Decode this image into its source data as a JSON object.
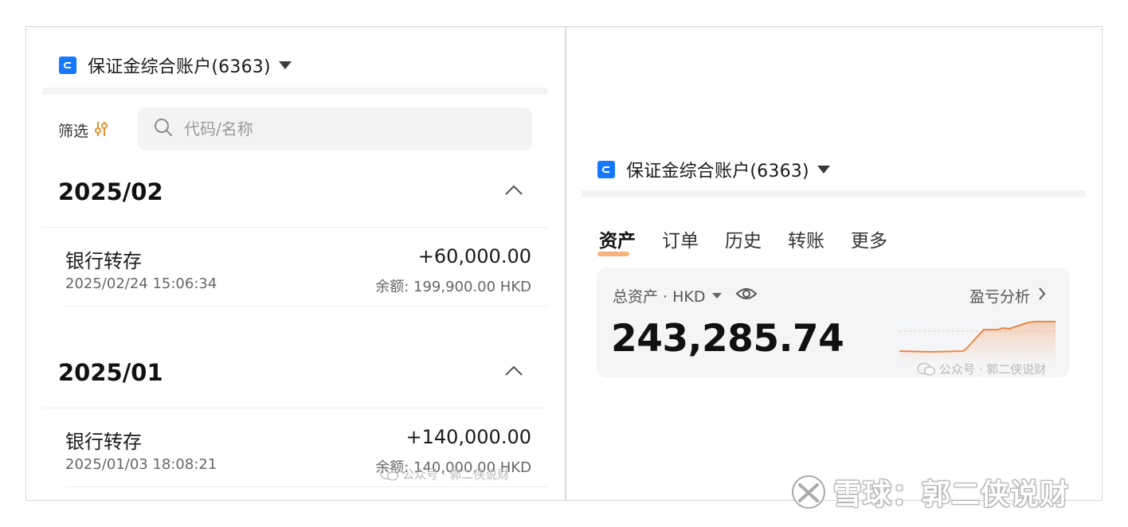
{
  "account": {
    "title": "保证金综合账户(6363)"
  },
  "left": {
    "filter_label": "筛选",
    "search_placeholder": "代码/名称",
    "groups": [
      {
        "month": "2025/02",
        "items": [
          {
            "type": "银行转存",
            "time": "2025/02/24 15:06:34",
            "amount": "+60,000.00",
            "balance": "余额: 199,900.00 HKD"
          }
        ]
      },
      {
        "month": "2025/01",
        "items": [
          {
            "type": "银行转存",
            "time": "2025/01/03 18:08:21",
            "amount": "+140,000.00",
            "balance": "余额: 140,000.00 HKD"
          }
        ]
      }
    ]
  },
  "right": {
    "tabs": [
      {
        "label": "资产",
        "active": true
      },
      {
        "label": "订单",
        "active": false
      },
      {
        "label": "历史",
        "active": false
      },
      {
        "label": "转账",
        "active": false
      },
      {
        "label": "更多",
        "active": false
      }
    ],
    "assets": {
      "label": "总资产 · HKD",
      "pnl_link": "盈亏分析",
      "total": "243,285.74"
    }
  },
  "watermarks": {
    "wechat": "公众号 · 郭二侠说财",
    "xueqiu": "雪球：郭二侠说财"
  },
  "colors": {
    "accent_blue": "#1677ff",
    "spark_orange": "#e8894a",
    "tab_underline": "#f2a15f"
  },
  "icons": {
    "account": "wallet-icon",
    "account_dropdown": "caret-down-icon",
    "filter": "filter-icon",
    "search": "search-icon",
    "collapse": "chevron-up-icon",
    "visibility": "eye-icon",
    "pnl": "chevron-right-icon"
  }
}
